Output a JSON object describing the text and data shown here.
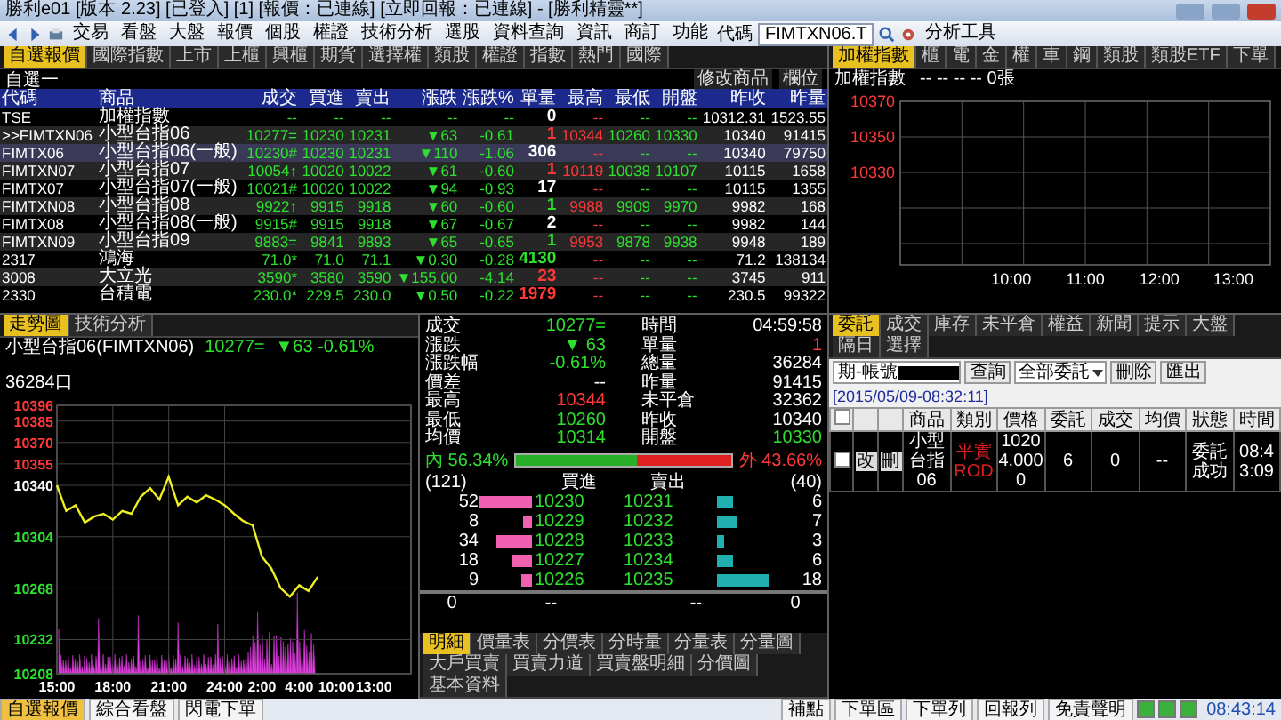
{
  "window": {
    "title": "勝利e01 [版本 2.23] [已登入] [1] [報價：已連線] [立即回報：已連線] - [勝利精靈**]"
  },
  "toolbar": {
    "menus": [
      "交易",
      "看盤",
      "大盤",
      "報價",
      "個股",
      "權證",
      "技術分析",
      "選股",
      "資料查詢",
      "資訊",
      "商訂",
      "功能"
    ],
    "code_label": "代碼",
    "code_value": "FIMTXN06.T",
    "tools": "分析工具"
  },
  "quote_board": {
    "tabs": [
      {
        "label": "自選報價",
        "selected": true
      },
      {
        "label": "國際指數",
        "selected": false
      },
      {
        "label": "上市",
        "selected": false
      },
      {
        "label": "上櫃",
        "selected": false
      },
      {
        "label": "興櫃",
        "selected": false
      },
      {
        "label": "期貨",
        "selected": false
      },
      {
        "label": "選擇權",
        "selected": false
      },
      {
        "label": "類股",
        "selected": false
      },
      {
        "label": "權證",
        "selected": false
      },
      {
        "label": "指數",
        "selected": false
      },
      {
        "label": "熱門",
        "selected": false
      },
      {
        "label": "國際",
        "selected": false
      }
    ],
    "group": "自選一",
    "edit_button": "修改商品",
    "columns_button": "欄位",
    "columns": [
      "代碼",
      "商品",
      "成交",
      "買進",
      "賣出",
      "漲跌",
      "漲跌%",
      "單量",
      "最高",
      "最低",
      "開盤",
      "昨收",
      "昨量"
    ],
    "rows": [
      {
        "cells": [
          "TSE",
          "加權指數",
          "--",
          "--",
          "--",
          "--",
          "--",
          "0",
          "--",
          "--",
          "--",
          "10312.31",
          "1523.55"
        ],
        "uptick": false,
        "downtick": false,
        "selected": false
      },
      {
        "cells": [
          ">>FIMTXN06",
          "小型台指06",
          "10277=",
          "10230",
          "10231",
          "▼63",
          "-0.61",
          "1",
          "10344",
          "10260",
          "10330",
          "10340",
          "91415"
        ],
        "uptick": true,
        "downtick": false,
        "selected": false
      },
      {
        "cells": [
          "FIMTX06",
          "小型台指06(一般)",
          "10230#",
          "10230",
          "10231",
          "▼110",
          "-1.06",
          "306",
          "--",
          "--",
          "--",
          "10340",
          "79750"
        ],
        "uptick": false,
        "downtick": false,
        "selected": true
      },
      {
        "cells": [
          "FIMTXN07",
          "小型台指07",
          "10054↑",
          "10020",
          "10022",
          "▼61",
          "-0.60",
          "1",
          "10119",
          "10038",
          "10107",
          "10115",
          "1658"
        ],
        "uptick": true,
        "downtick": false,
        "selected": false
      },
      {
        "cells": [
          "FIMTX07",
          "小型台指07(一般)",
          "10021#",
          "10020",
          "10022",
          "▼94",
          "-0.93",
          "17",
          "--",
          "--",
          "--",
          "10115",
          "1355"
        ],
        "uptick": false,
        "downtick": false,
        "selected": false
      },
      {
        "cells": [
          "FIMTXN08",
          "小型台指08",
          "9922↑",
          "9915",
          "9918",
          "▼60",
          "-0.60",
          "1",
          "9988",
          "9909",
          "9970",
          "9982",
          "168"
        ],
        "uptick": false,
        "downtick": true,
        "selected": false
      },
      {
        "cells": [
          "FIMTX08",
          "小型台指08(一般)",
          "9915#",
          "9915",
          "9918",
          "▼67",
          "-0.67",
          "2",
          "--",
          "--",
          "--",
          "9982",
          "144"
        ],
        "uptick": false,
        "downtick": false,
        "selected": false
      },
      {
        "cells": [
          "FIMTXN09",
          "小型台指09",
          "9883=",
          "9841",
          "9893",
          "▼65",
          "-0.65",
          "1",
          "9953",
          "9878",
          "9938",
          "9948",
          "189"
        ],
        "uptick": false,
        "downtick": true,
        "selected": false
      },
      {
        "cells": [
          "2317",
          "鴻海",
          "71.0*",
          "71.0",
          "71.1",
          "▼0.30",
          "-0.28",
          "4130",
          "--",
          "--",
          "--",
          "71.2",
          "138134"
        ],
        "uptick": false,
        "downtick": true,
        "selected": false
      },
      {
        "cells": [
          "3008",
          "大立光",
          "3590*",
          "3580",
          "3590",
          "▼155.00",
          "-4.14",
          "23",
          "--",
          "--",
          "--",
          "3745",
          "911"
        ],
        "uptick": true,
        "downtick": false,
        "selected": false
      },
      {
        "cells": [
          "2330",
          "台積電",
          "230.0*",
          "229.5",
          "230.0",
          "▼0.50",
          "-0.22",
          "1979",
          "--",
          "--",
          "--",
          "230.5",
          "99322"
        ],
        "uptick": true,
        "downtick": false,
        "selected": false
      }
    ]
  },
  "index_chart": {
    "tabs": [
      {
        "label": "加權指數",
        "selected": true
      },
      {
        "label": "櫃",
        "selected": false
      },
      {
        "label": "電",
        "selected": false
      },
      {
        "label": "金",
        "selected": false
      },
      {
        "label": "權",
        "selected": false
      },
      {
        "label": "車",
        "selected": false
      },
      {
        "label": "鋼",
        "selected": false
      },
      {
        "label": "類股",
        "selected": false
      },
      {
        "label": "類股ETF",
        "selected": false
      },
      {
        "label": "下單",
        "selected": false
      }
    ],
    "title": "加權指數",
    "readout": "-- -- -- -- 0張",
    "yticks": [
      "10370",
      "10350",
      "10330"
    ],
    "xticks": [
      "10:00",
      "11:00",
      "12:00",
      "13:00"
    ]
  },
  "price_chart": {
    "tabs": [
      {
        "label": "走勢圖",
        "selected": true
      },
      {
        "label": "技術分析",
        "selected": false
      }
    ],
    "next_day_labels": [
      "2:00",
      "4:00",
      "10:00",
      "13:00"
    ],
    "name": "小型台指06(FIMTXN06)",
    "last": "10277=",
    "change": "▼63 -0.61%",
    "volume": "36284口",
    "chart_data": {
      "type": "line",
      "grid": true,
      "x": [
        15,
        15.5,
        16,
        16.5,
        17,
        17.5,
        18,
        18.5,
        19,
        19.5,
        20,
        20.5,
        21,
        21.5,
        22,
        22.5,
        23,
        23.5,
        24,
        24.5,
        25,
        25.5,
        26,
        26.5,
        27,
        27.5,
        28,
        28.5,
        29
      ],
      "xlim": [
        15,
        34
      ],
      "xticks": [
        {
          "value": 15,
          "label": "15:00"
        },
        {
          "value": 18,
          "label": "18:00"
        },
        {
          "value": 21,
          "label": "21:00"
        },
        {
          "value": 24,
          "label": "24:00"
        }
      ],
      "series": [
        {
          "color": "#f0f020",
          "values": [
            10340,
            10322,
            10326,
            10314,
            10318,
            10320,
            10316,
            10322,
            10320,
            10332,
            10338,
            10330,
            10346,
            10326,
            10332,
            10328,
            10333,
            10330,
            10326,
            10320,
            10315,
            10312,
            10290,
            10282,
            10268,
            10262,
            10270,
            10266,
            10276
          ]
        }
      ],
      "ylim": [
        10208,
        10396
      ],
      "yticks": [
        {
          "value": 10396,
          "label": "10396"
        },
        {
          "value": 10385,
          "label": "10385"
        },
        {
          "value": 10370,
          "label": "10370"
        },
        {
          "value": 10355,
          "label": "10355"
        },
        {
          "value": 10340,
          "label": "10340"
        },
        {
          "value": 10304,
          "label": "10304"
        },
        {
          "value": 10268,
          "label": "10268"
        },
        {
          "value": 10232,
          "label": "10232"
        },
        {
          "value": 10208,
          "label": "10208"
        }
      ]
    }
  },
  "quote_detail": {
    "left": [
      {
        "label": "成交",
        "value": "10277=",
        "color": "#2ee02e"
      },
      {
        "label": "漲跌",
        "value": "▼ 63",
        "color": "#2ee02e"
      },
      {
        "label": "漲跌幅",
        "value": "-0.61%",
        "color": "#2ee02e"
      },
      {
        "label": "價差",
        "value": "--",
        "color": "#ffffff"
      },
      {
        "label": "最高",
        "value": "10344",
        "color": "#ff3838"
      },
      {
        "label": "最低",
        "value": "10260",
        "color": "#2ee02e"
      },
      {
        "label": "均價",
        "value": "10314",
        "color": "#2ee02e"
      }
    ],
    "right": [
      {
        "label": "時間",
        "value": "04:59:58",
        "color": "#ffffff"
      },
      {
        "label": "單量",
        "value": "1",
        "color": "#ff3838"
      },
      {
        "label": "總量",
        "value": "36284",
        "color": "#ffffff"
      },
      {
        "label": "昨量",
        "value": "91415",
        "color": "#ffffff"
      },
      {
        "label": "未平倉",
        "value": "32362",
        "color": "#ffffff"
      },
      {
        "label": "昨收",
        "value": "10340",
        "color": "#ffffff"
      },
      {
        "label": "開盤",
        "value": "10330",
        "color": "#2ee02e"
      }
    ],
    "inner": {
      "label": "內 56.34%",
      "level": 0.5634
    },
    "outer": {
      "label": "外 43.66%"
    },
    "bid_total": "(121)",
    "bid_header": "買進",
    "ask_header": "賣出",
    "ask_total": "(40)",
    "book": [
      {
        "bid_qty": "52",
        "bid": "10230",
        "ask": "10231",
        "ask_qty": "6"
      },
      {
        "bid_qty": "8",
        "bid": "10229",
        "ask": "10232",
        "ask_qty": "7"
      },
      {
        "bid_qty": "34",
        "bid": "10228",
        "ask": "10233",
        "ask_qty": "3"
      },
      {
        "bid_qty": "18",
        "bid": "10227",
        "ask": "10234",
        "ask_qty": "6"
      },
      {
        "bid_qty": "9",
        "bid": "10226",
        "ask": "10235",
        "ask_qty": "18"
      }
    ],
    "summary": [
      "0",
      "--",
      "--",
      "0"
    ],
    "tabs": [
      {
        "label": "明細",
        "selected": true
      },
      {
        "label": "價量表",
        "selected": false
      },
      {
        "label": "分價表",
        "selected": false
      },
      {
        "label": "分時量",
        "selected": false
      },
      {
        "label": "分量表",
        "selected": false
      },
      {
        "label": "分量圖",
        "selected": false
      },
      {
        "label": "大戶買賣",
        "selected": false
      },
      {
        "label": "買賣力道",
        "selected": false
      },
      {
        "label": "買賣盤明細",
        "selected": false
      },
      {
        "label": "分價圖",
        "selected": false
      },
      {
        "label": "基本資料",
        "selected": false
      }
    ]
  },
  "orders": {
    "tabs": [
      {
        "label": "委託",
        "selected": true
      },
      {
        "label": "成交",
        "selected": false
      },
      {
        "label": "庫存",
        "selected": false
      },
      {
        "label": "未平倉",
        "selected": false
      },
      {
        "label": "權益",
        "selected": false
      },
      {
        "label": "新聞",
        "selected": false
      },
      {
        "label": "提示",
        "selected": false
      },
      {
        "label": "大盤",
        "selected": false
      },
      {
        "label": "隔日",
        "selected": false
      },
      {
        "label": "選擇",
        "selected": false
      }
    ],
    "account_label": "期-帳號",
    "query_button": "查詢",
    "filter": "全部委託",
    "delete_button": "刪除",
    "export_button": "匯出",
    "timestamp": "[2015/05/09-08:32:11]",
    "select_all": {
      "checked": false
    },
    "columns": [
      "商品",
      "類別",
      "價格",
      "委託",
      "成交",
      "均價",
      "狀態",
      "時間"
    ],
    "rows": [
      {
        "checked": false,
        "edit": "改",
        "cancel": "刪",
        "cells": [
          "小型台指06",
          "平實ROD",
          "10204.0000",
          "6",
          "0",
          "--",
          "委託成功",
          "08:43:09"
        ]
      }
    ]
  },
  "status_bar": {
    "tabs": [
      {
        "label": "自選報價",
        "selected": true
      },
      {
        "label": "綜合看盤",
        "selected": false
      },
      {
        "label": "閃電下單",
        "selected": false
      }
    ],
    "buttons": [
      "補點",
      "下單區",
      "下單列",
      "回報列",
      "免責聲明"
    ],
    "toggles": [
      {
        "on": true
      },
      {
        "on": true
      },
      {
        "on": true
      }
    ],
    "time": "08:43:14"
  }
}
